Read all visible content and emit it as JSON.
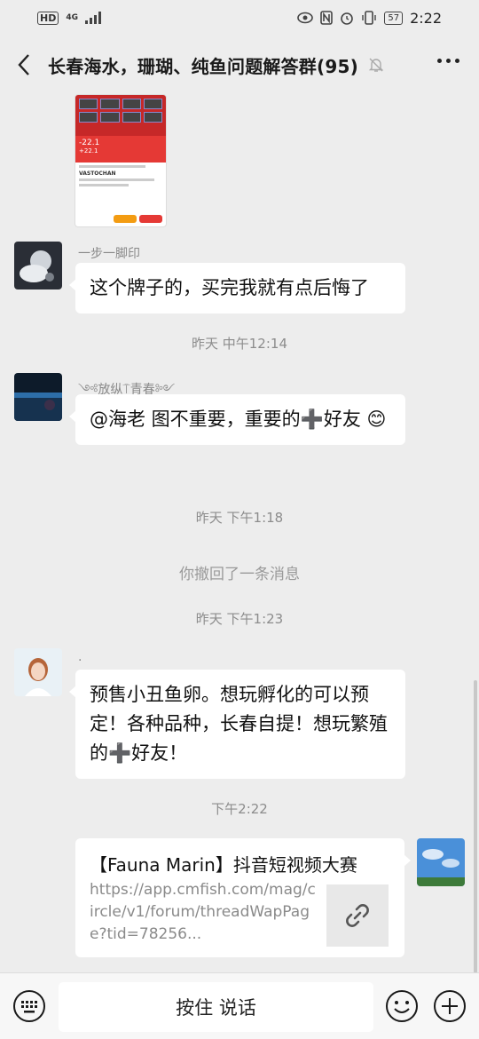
{
  "status": {
    "hd": "HD",
    "network": "4G",
    "battery": "57",
    "time": "2:22"
  },
  "nav": {
    "title": "长春海水，珊瑚、纯鱼问题解答群(95)"
  },
  "shared_image": {
    "price1": "-22.1",
    "price2": "+22.1",
    "product_line": "VASTOCHAN"
  },
  "messages": [
    {
      "nick": "一步一脚印",
      "text": "这个牌子的，买完我就有点后悔了"
    },
    {
      "nick": "༺放纵⍑青春༻",
      "text": "@海老  图不重要，重要的➕好友 😊"
    },
    {
      "nick": ".",
      "text": "预售小丑鱼卵。想玩孵化的可以预定！各种品种，长春自提！想玩繁殖的➕好友！"
    }
  ],
  "timestamps": {
    "t1": "昨天 中午12:14",
    "t2": "昨天 下午1:18",
    "t3": "昨天 下午1:23",
    "t4": "下午2:22"
  },
  "system": {
    "recalled": "你撤回了一条消息"
  },
  "card": {
    "title": "【Fauna Marin】抖音短视频大赛",
    "url": "https://app.cmfish.com/mag/circle/v1/forum/threadWapPage?tid=78256..."
  },
  "input": {
    "hold_to_talk": "按住 说话"
  },
  "colors": {
    "background": "#ededed",
    "bubble": "#ffffff",
    "timestamp": "#8c8c8c"
  }
}
